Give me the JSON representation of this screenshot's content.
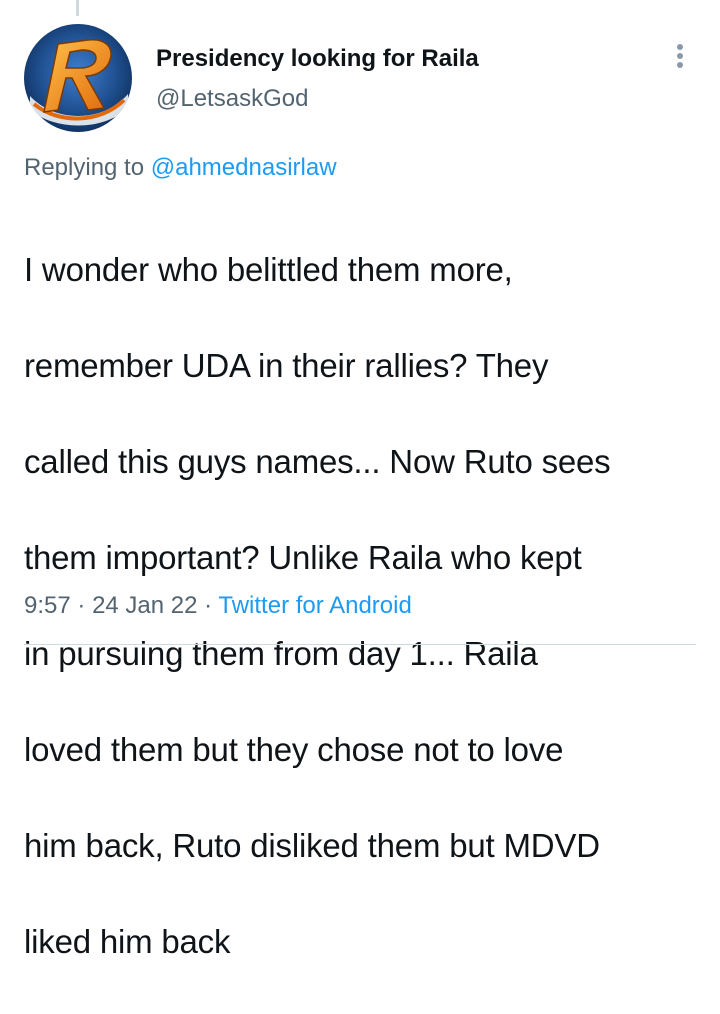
{
  "tweet": {
    "author": {
      "display_name": "Presidency looking for Raila",
      "handle": "@LetsaskGod",
      "avatar_letter": "R"
    },
    "replying": {
      "prefix": "Replying to",
      "mention": "@ahmednasirlaw"
    },
    "text_lines": [
      "I wonder who belittled them more,",
      "remember UDA in their rallies? They",
      "called this guys names... Now Ruto sees",
      "them important? Unlike Raila who kept",
      "in pursuing them from day 1... Raila",
      "loved them but they chose not to love",
      "him back, Ruto disliked them but MDVD",
      "liked him back"
    ],
    "time": "9:57",
    "separator": "·",
    "date": "24 Jan 22",
    "source": "Twitter for Android"
  },
  "colors": {
    "text": "#0f1419",
    "secondary": "#536471",
    "link": "#1d9bf0",
    "avatar_blue": "#1f4f8f",
    "avatar_orange": "#f08a1a"
  },
  "icons": {
    "more": "more-vertical-icon"
  }
}
